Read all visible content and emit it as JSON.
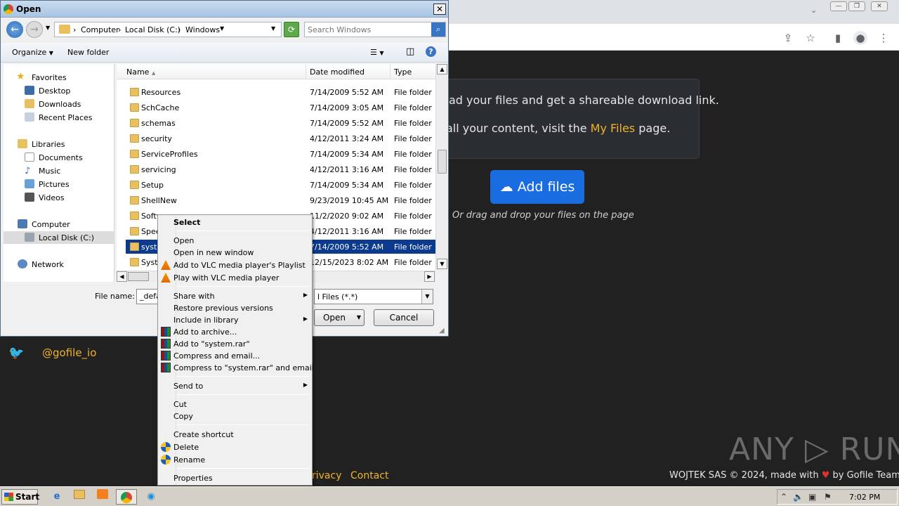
{
  "dialog": {
    "title": "Open",
    "breadcrumbs": [
      "Computer",
      "Local Disk (C:)",
      "Windows"
    ],
    "search_placeholder": "Search Windows",
    "toolbar": {
      "organize": "Organize",
      "new_folder": "New folder"
    },
    "nav": {
      "favorites": "Favorites",
      "desktop": "Desktop",
      "downloads": "Downloads",
      "recent": "Recent Places",
      "libraries": "Libraries",
      "documents": "Documents",
      "music": "Music",
      "pictures": "Pictures",
      "videos": "Videos",
      "computer": "Computer",
      "local_disk": "Local Disk (C:)",
      "network": "Network"
    },
    "columns": {
      "name": "Name",
      "date": "Date modified",
      "type": "Type"
    },
    "rows": [
      {
        "name": "Resources",
        "date": "7/14/2009 5:52 AM",
        "type": "File folder"
      },
      {
        "name": "SchCache",
        "date": "7/14/2009 3:05 AM",
        "type": "File folder"
      },
      {
        "name": "schemas",
        "date": "7/14/2009 5:52 AM",
        "type": "File folder"
      },
      {
        "name": "security",
        "date": "4/12/2011 3:24 AM",
        "type": "File folder"
      },
      {
        "name": "ServiceProfiles",
        "date": "7/14/2009 5:34 AM",
        "type": "File folder"
      },
      {
        "name": "servicing",
        "date": "4/12/2011 3:16 AM",
        "type": "File folder"
      },
      {
        "name": "Setup",
        "date": "7/14/2009 5:34 AM",
        "type": "File folder"
      },
      {
        "name": "ShellNew",
        "date": "9/23/2019 10:45 AM",
        "type": "File folder"
      },
      {
        "name": "Softw",
        "date": "11/2/2020 9:02 AM",
        "type": "File folder"
      },
      {
        "name": "Spee",
        "date": "4/12/2011 3:16 AM",
        "type": "File folder"
      },
      {
        "name": "syste",
        "date": "7/14/2009 5:52 AM",
        "type": "File folder"
      },
      {
        "name": "Syste",
        "date": "12/15/2023 8:02 AM",
        "type": "File folder"
      }
    ],
    "selected_row": 10,
    "file_name_label": "File name:",
    "file_name_value": "_defa",
    "filter_value": "l Files (*.*)",
    "open_label": "Open",
    "cancel_label": "Cancel"
  },
  "context_menu": {
    "select": "Select",
    "open": "Open",
    "open_new_window": "Open in new window",
    "vlc_playlist": "Add to VLC media player's Playlist",
    "vlc_play": "Play with VLC media player",
    "share_with": "Share with",
    "restore": "Restore previous versions",
    "include_library": "Include in library",
    "add_archive": "Add to archive...",
    "add_rar": "Add to \"system.rar\"",
    "compress_email": "Compress and email...",
    "compress_rar_email": "Compress to \"system.rar\" and email",
    "send_to": "Send to",
    "cut": "Cut",
    "copy": "Copy",
    "create_shortcut": "Create shortcut",
    "delete": "Delete",
    "rename": "Rename",
    "properties": "Properties"
  },
  "web": {
    "info_line1": "ad your files and get a shareable download link.",
    "info_line2_a": "all your content, visit the ",
    "info_line2_link": "My Files",
    "info_line2_b": " page.",
    "add_files": "Add files",
    "drag_text": "Or drag and drop your files on the page",
    "twitter": "@gofile_io",
    "privacy": "rivacy",
    "contact": "Contact",
    "copyright_a": "WOJTEK SAS © 2024, made with ",
    "copyright_b": " by Gofile Team",
    "watermark": "ANY ▷ RUN"
  },
  "taskbar": {
    "start": "Start",
    "clock": "7:02 PM"
  },
  "colors": {
    "accent_blue": "#1a6de0",
    "link_yellow": "#f0b429",
    "selection": "#0b3a8e"
  }
}
